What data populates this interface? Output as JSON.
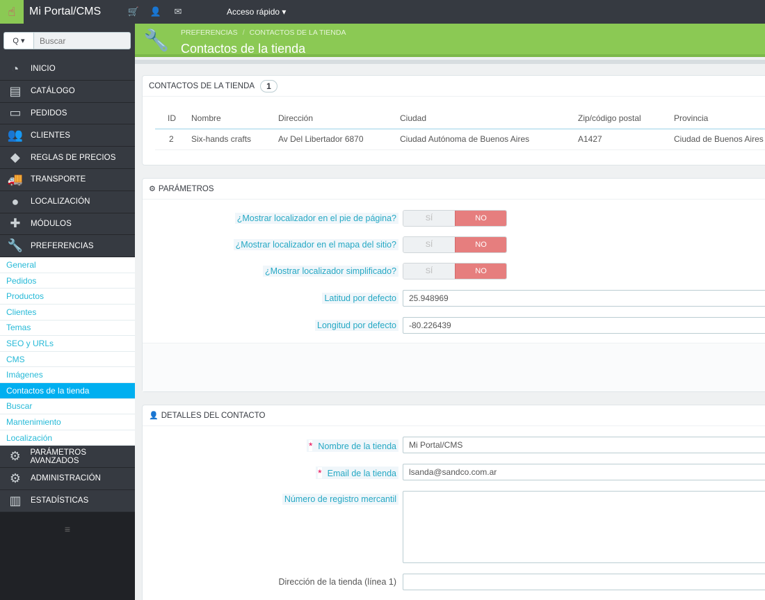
{
  "topbar": {
    "brand": "Mi Portal/CMS",
    "quick_access": "Acceso rápido ▾",
    "icons": [
      "cart-icon",
      "user-icon",
      "envelope-icon"
    ]
  },
  "sidebar": {
    "search_placeholder": "Buscar",
    "search_button": "Q ▾",
    "items": [
      {
        "label": "INICIO",
        "icon": "dashboard-icon"
      },
      {
        "label": "CATÁLOGO",
        "icon": "book-icon"
      },
      {
        "label": "PEDIDOS",
        "icon": "credit-card-icon"
      },
      {
        "label": "CLIENTES",
        "icon": "users-icon"
      },
      {
        "label": "REGLAS DE PRECIOS",
        "icon": "tags-icon"
      },
      {
        "label": "TRANSPORTE",
        "icon": "truck-icon"
      },
      {
        "label": "LOCALIZACIÓN",
        "icon": "globe-icon"
      },
      {
        "label": "MÓDULOS",
        "icon": "puzzle-icon"
      },
      {
        "label": "PREFERENCIAS",
        "icon": "wrench-icon"
      }
    ],
    "submenu": [
      "General",
      "Pedidos",
      "Productos",
      "Clientes",
      "Temas",
      "SEO y URLs",
      "CMS",
      "Imágenes",
      "Contactos de la tienda",
      "Buscar",
      "Mantenimiento",
      "Localización"
    ],
    "submenu_active": "Contactos de la tienda",
    "bottom_items": [
      {
        "label": "PARÁMETROS AVANZADOS",
        "icon": "cogs-icon"
      },
      {
        "label": "ADMINISTRACIÓN",
        "icon": "cog-icon"
      },
      {
        "label": "ESTADÍSTICAS",
        "icon": "bar-chart-icon"
      }
    ]
  },
  "header": {
    "breadcrumb_1": "PREFERENCIAS",
    "breadcrumb_sep": "/",
    "breadcrumb_2": "CONTACTOS DE LA TIENDA",
    "title": "Contactos de la tienda"
  },
  "contacts": {
    "title": "CONTACTOS DE LA TIENDA",
    "count": "1",
    "columns": [
      "ID",
      "Nombre",
      "Dirección",
      "Ciudad",
      "Zip/código postal",
      "Provincia"
    ],
    "rows": [
      [
        "2",
        "Six-hands crafts",
        "Av Del Libertador 6870",
        "Ciudad Autónoma de Buenos Aires",
        "A1427",
        "Ciudad de Buenos Aires"
      ]
    ]
  },
  "params": {
    "title": "PARÁMETROS",
    "toggle_yes": "SÍ",
    "toggle_no": "NO",
    "footer_label": "¿Mostrar localizador en el pie de página?",
    "sitemap_label": "¿Mostrar localizador en el mapa del sitio?",
    "simplified_label": "¿Mostrar localizador simplificado?",
    "lat_label": "Latitud por defecto",
    "lat_value": "25.948969",
    "lng_label": "Longitud por defecto",
    "lng_value": "-80.226439"
  },
  "contact_details": {
    "title": "DETALLES DEL CONTACTO",
    "required_mark": "*",
    "shop_name_label": "Nombre de la tienda",
    "shop_name_value": "Mi Portal/CMS",
    "email_label": "Email de la tienda",
    "email_value": "lsanda@sandco.com.ar",
    "registration_label": "Número de registro mercantil",
    "address1_label": "Dirección de la tienda (línea 1)"
  }
}
